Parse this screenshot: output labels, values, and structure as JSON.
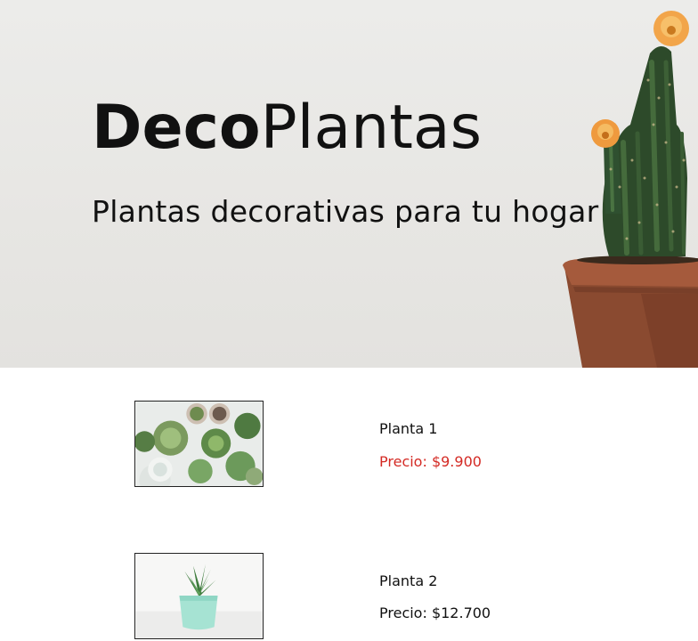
{
  "header": {
    "brand_bold": "Deco",
    "brand_light": "Plantas",
    "tagline": "Plantas decorativas para tu hogar"
  },
  "products": [
    {
      "name": "Planta 1",
      "price": "Precio: $9.900",
      "price_color": "#d42a24",
      "image": "succulents-top-view"
    },
    {
      "name": "Planta 2",
      "price": "Precio: $12.700",
      "price_color": "#111111",
      "image": "succulent-mint-pot"
    }
  ],
  "colors": {
    "hero_bg": "#e9e8e5",
    "accent_price": "#d42a24"
  }
}
